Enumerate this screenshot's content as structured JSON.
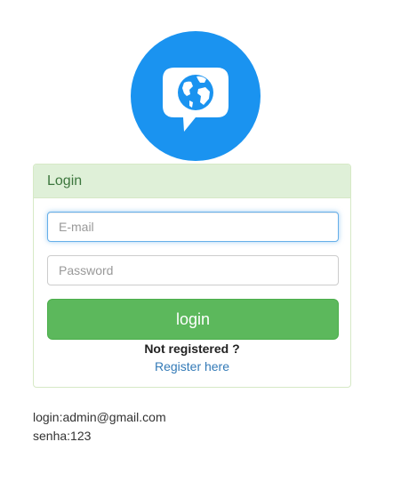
{
  "logo": {
    "icon": "chat-globe-icon",
    "circle_color": "#1a93f0",
    "bubble_color": "#ffffff"
  },
  "panel": {
    "heading": "Login",
    "email_placeholder": "E-mail",
    "password_placeholder": "Password",
    "login_label": "login",
    "not_registered_text": "Not registered ?",
    "register_link_text": "Register here"
  },
  "credentials": {
    "login_line": "login:admin@gmail.com",
    "password_line": "senha:123"
  },
  "colors": {
    "panel_border": "#d6e9c6",
    "panel_heading_bg": "#dff0d8",
    "panel_heading_text": "#3c763d",
    "button_bg": "#5cb85c",
    "link": "#337ab7",
    "focus": "#66afe9"
  }
}
